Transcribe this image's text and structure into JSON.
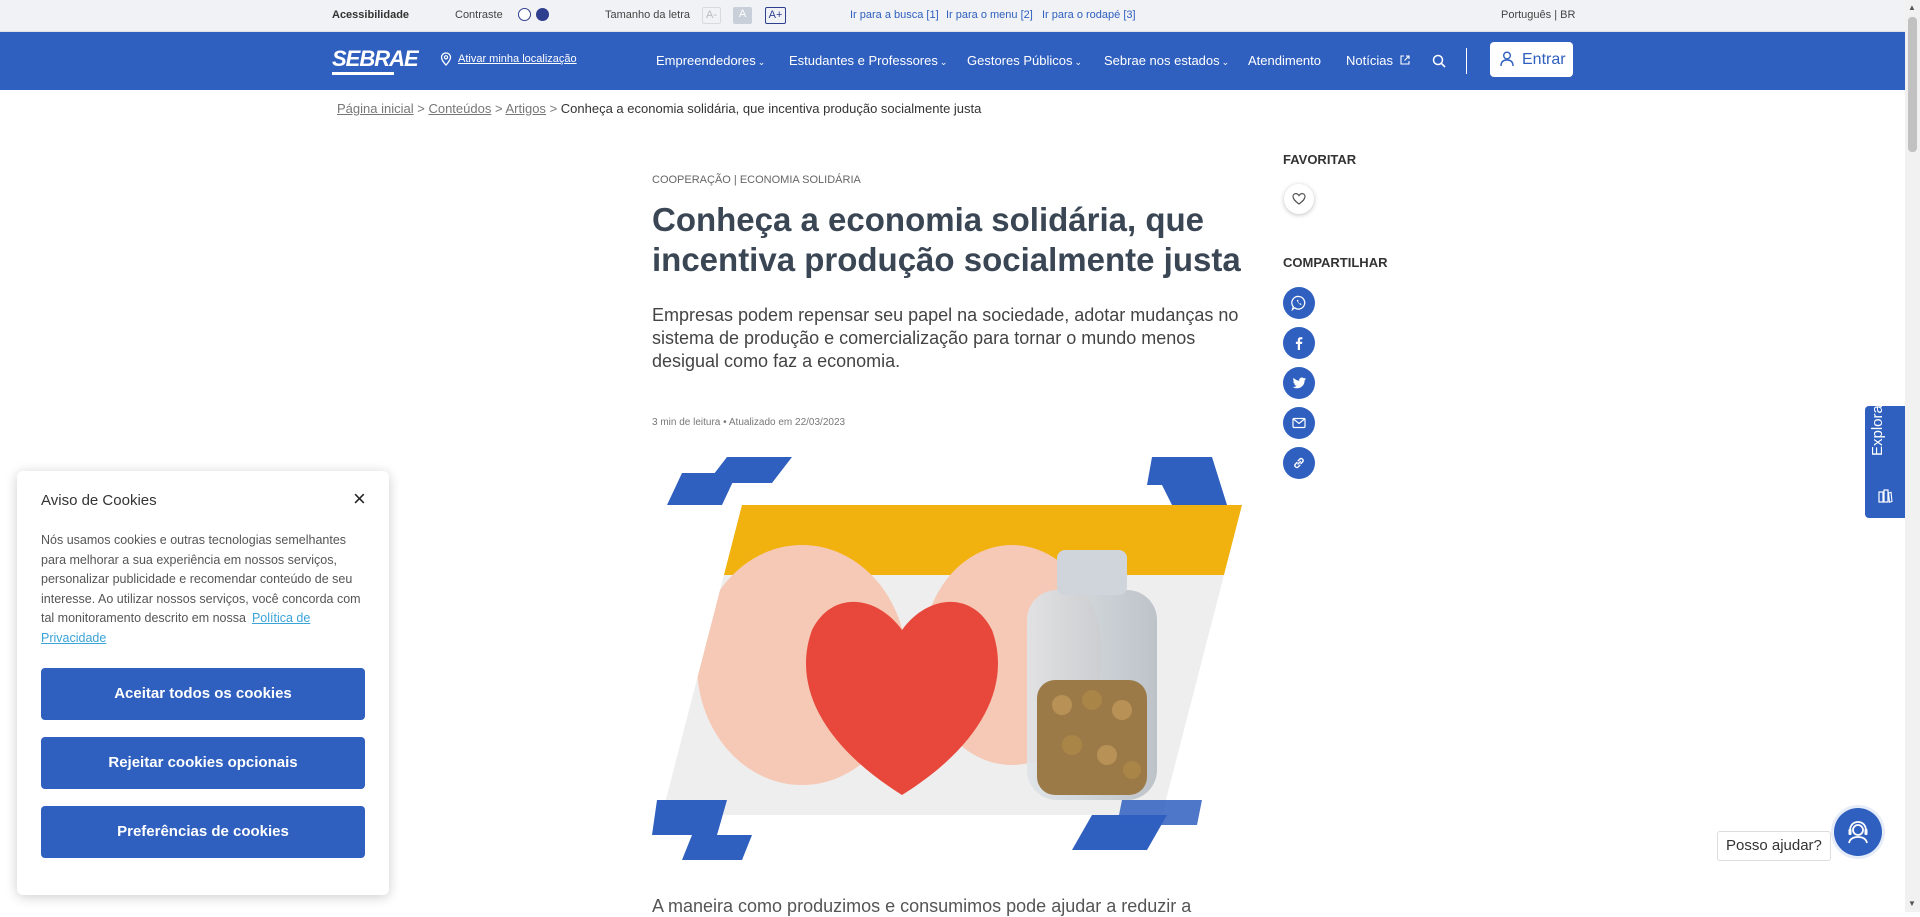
{
  "accessibility_bar": {
    "accessibility_label": "Acessibilidade",
    "contrast_label": "Contraste",
    "font_size_label": "Tamanho da letra",
    "font_decrease": "A-",
    "font_normal": "A",
    "font_increase": "A+",
    "skip_search": "Ir para a busca [1]",
    "skip_menu": "Ir para o menu [2]",
    "skip_footer": "Ir para o rodapé [3]",
    "language": "Português | BR"
  },
  "header": {
    "logo": "SEBRAE",
    "location_link": "Ativar minha localização",
    "nav": {
      "empreendedores": "Empreendedores",
      "estudantes": "Estudantes e Professores",
      "gestores": "Gestores Públicos",
      "estados": "Sebrae nos estados",
      "atendimento": "Atendimento",
      "noticias": "Notícias"
    },
    "login": "Entrar"
  },
  "breadcrumb": {
    "home": "Página inicial",
    "sep": ">",
    "conteudos": "Conteúdos",
    "artigos": "Artigos",
    "current": "Conheça a economia solidária, que incentiva produção socialmente justa"
  },
  "article": {
    "category": "COOPERAÇÃO | ECONOMIA SOLIDÁRIA",
    "title": "Conheça a economia solidária, que incentiva produção socialmente justa",
    "subtitle": "Empresas podem repensar seu papel na sociedade, adotar mudanças no sistema de produção e comercialização para tornar o mundo menos desigual como faz a economia.",
    "meta": "3 min de leitura • Atualizado em 22/03/2023",
    "body_start": "A maneira como produzimos e consumimos pode ajudar a reduzir a"
  },
  "sidebar": {
    "favorite_label": "FAVORITAR",
    "share_label": "COMPARTILHAR"
  },
  "explorar": "Explorar",
  "cookie_notice": {
    "title": "Aviso de Cookies",
    "close": "×",
    "text": "Nós usamos cookies e outras tecnologias semelhantes para melhorar a sua experiência em nossos serviços, personalizar publicidade e recomendar conteúdo de seu interesse. Ao utilizar nossos serviços, você concorda com tal monitoramento descrito em nossa",
    "policy_link": "Política de Privacidade",
    "accept_all": "Aceitar todos os cookies",
    "reject_optional": "Rejeitar cookies opcionais",
    "preferences": "Preferências de cookies"
  },
  "help": {
    "label": "Posso ajudar?"
  },
  "colors": {
    "brand_blue": "#2f5fbf",
    "link_cyan": "#3aa3d8",
    "title_gray": "#3a4654"
  }
}
